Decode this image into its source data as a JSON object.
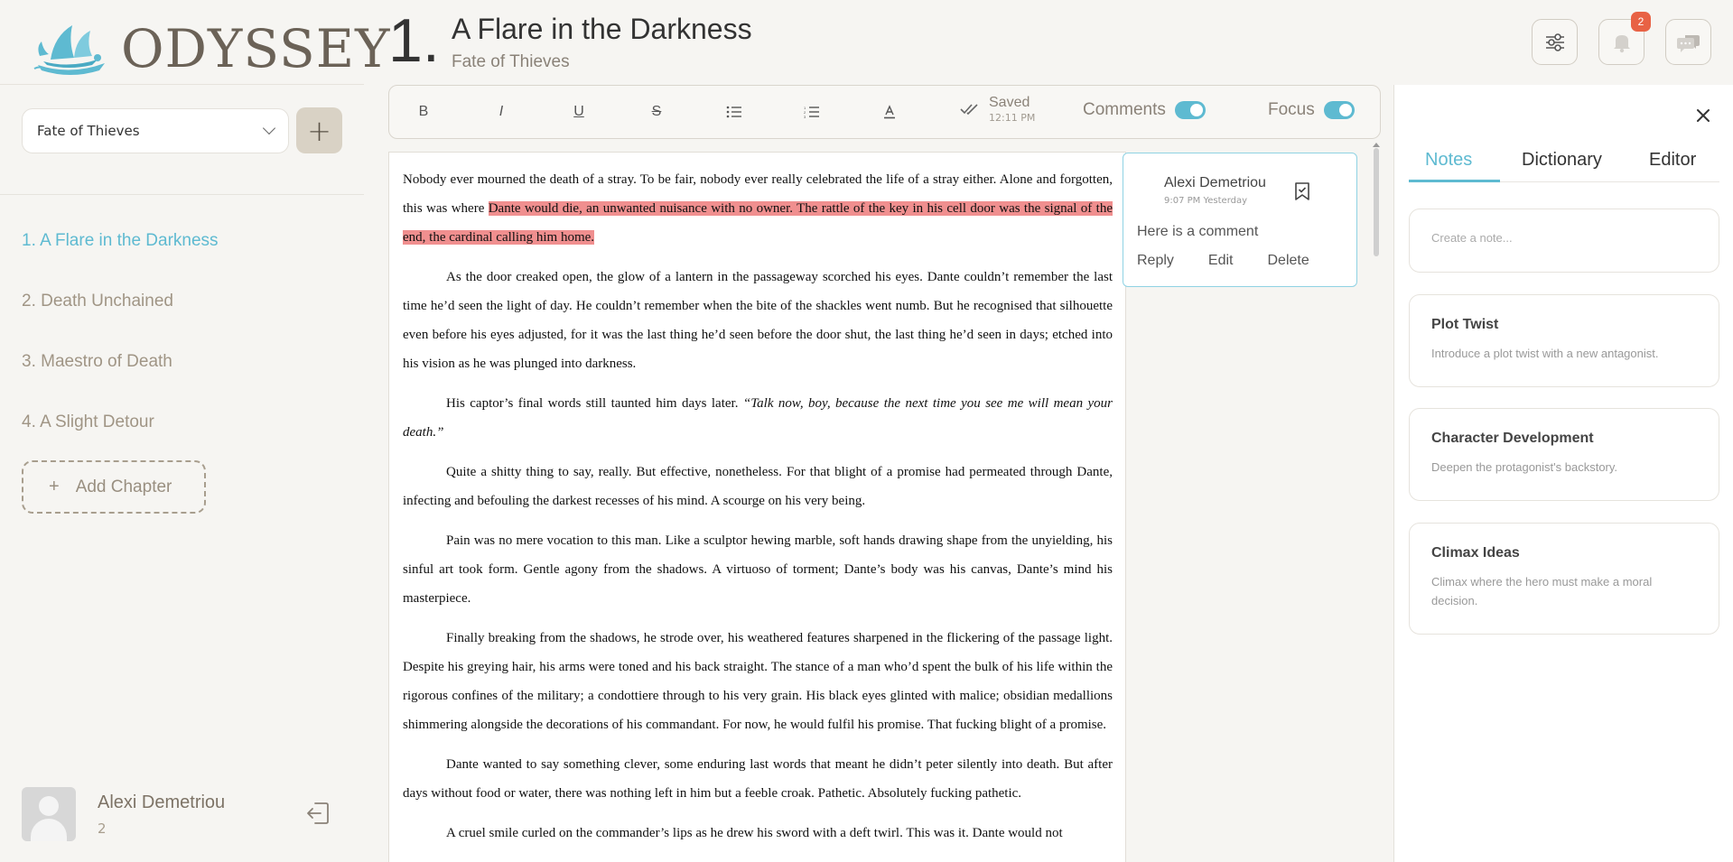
{
  "app": {
    "logo_text": "ODYSSEY"
  },
  "sidebar": {
    "book_select": "Fate of Thieves",
    "add_book": "+",
    "chapters": [
      {
        "label": "1. A Flare in the Darkness"
      },
      {
        "label": "2. Death Unchained"
      },
      {
        "label": "3. Maestro of Death"
      },
      {
        "label": "4. A Slight Detour"
      }
    ],
    "add_chapter": "Add Chapter",
    "add_chapter_plus": "+",
    "user": {
      "name": "Alexi Demetriou",
      "sub": "2"
    }
  },
  "header": {
    "chapter_number": "1.",
    "chapter_title": "A Flare in the Darkness",
    "book_title": "Fate of Thieves",
    "notifications_count": "2"
  },
  "toolbar": {
    "bold": "B",
    "italic": "I",
    "underline": "U",
    "strike": "S",
    "saved_label": "Saved",
    "saved_time": "12:11 PM",
    "comments_label": "Comments",
    "focus_label": "Focus"
  },
  "editor": {
    "p1_a": "Nobody ever mourned the death of a stray. To be fair, nobody ever really celebrated the life of a stray either. Alone and forgotten, this was where ",
    "p1_highlight": "Dante would die, an unwanted nuisance with no owner. The rattle of the key in his cell door was the signal of the end, the cardinal calling him home.",
    "p2": "As the door creaked open, the glow of a lantern in the passageway scorched his eyes. Dante couldn’t remember the last time he’d seen the light of day. He couldn’t remember when the bite of the shackles went numb. But he recognised that silhouette even before his eyes adjusted, for it was the last thing he’d seen before the door shut, the last thing he’d seen in days; etched into his vision as he was plunged into darkness.",
    "p3_a": "His captor’s final words still taunted him days later. ",
    "p3_italic": "“Talk now, boy, because the next time you see me will mean your death.”",
    "p4": "Quite a shitty thing to say, really. But effective, nonetheless. For that blight of a promise had permeated through Dante, infecting and befouling the darkest recesses of his mind. A scourge on his very being.",
    "p5": "Pain was no mere vocation to this man. Like a sculptor hewing marble, soft hands drawing shape from the unyielding, his sinful art took form. Gentle agony from the shadows. A virtuoso of torment; Dante’s body was his canvas, Dante’s mind his masterpiece.",
    "p6": "Finally breaking from the shadows, he strode over, his weathered features sharpened in the flickering of the passage light. Despite his greying hair, his arms were toned and his back straight. The stance of a man who’d spent the bulk of his life within the rigorous confines of the military; a condottiere through to his very grain. His black eyes glinted with malice; obsidian medallions shimmering alongside the decorations of his commandant. For now, he would fulfil his promise. That fucking blight of a promise.",
    "p7": "Dante wanted to say something clever, some enduring last words that meant he didn’t peter silently into death. But after days without food or water, there was nothing left in him but a feeble croak. Pathetic. Absolutely fucking pathetic.",
    "p8": "A cruel smile curled on the commander’s lips as he drew his sword with a deft twirl. This was it. Dante would not"
  },
  "comment": {
    "author": "Alexi Demetriou",
    "time": "9:07 PM Yesterday",
    "body": "Here is a comment",
    "reply": "Reply",
    "edit": "Edit",
    "delete": "Delete"
  },
  "right_panel": {
    "tabs": [
      "Notes",
      "Dictionary",
      "Editor"
    ],
    "note_placeholder": "Create a note...",
    "notes": [
      {
        "title": "Plot Twist",
        "body": "Introduce a plot twist with a new antagonist."
      },
      {
        "title": "Character Development",
        "body": "Deepen the protagonist's backstory."
      },
      {
        "title": "Climax Ideas",
        "body": "Climax where the hero must make a moral decision."
      }
    ]
  },
  "colors": {
    "accent": "#5ebad1",
    "highlight": "#f08f8f",
    "badge": "#e86245",
    "background": "#f6f5f2"
  }
}
